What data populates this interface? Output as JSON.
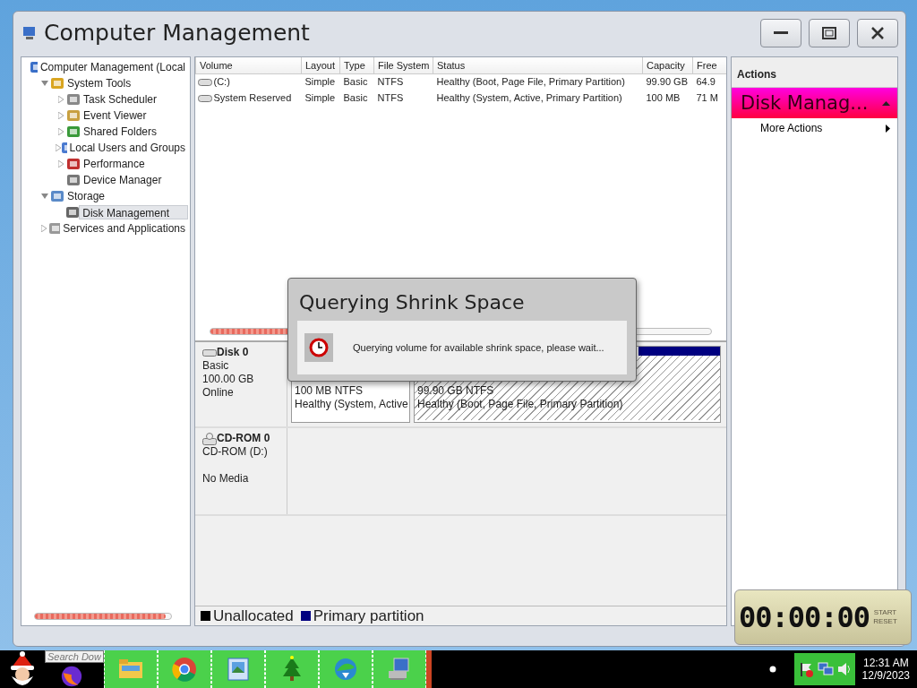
{
  "window": {
    "title": "Computer Management"
  },
  "tree": [
    {
      "label": "Computer Management (Local",
      "selected": false,
      "children": [
        {
          "label": "System Tools",
          "expanded": true,
          "selected": false,
          "children": [
            {
              "label": "Task Scheduler",
              "expanded": false,
              "selected": false
            },
            {
              "label": "Event Viewer",
              "expanded": false,
              "selected": false
            },
            {
              "label": "Shared Folders",
              "expanded": false,
              "selected": false
            },
            {
              "label": "Local Users and Groups",
              "expanded": false,
              "selected": false
            },
            {
              "label": "Performance",
              "expanded": false,
              "selected": false
            },
            {
              "label": "Device Manager",
              "selected": false
            }
          ]
        },
        {
          "label": "Storage",
          "expanded": true,
          "selected": false,
          "children": [
            {
              "label": "Disk Management",
              "selected": true
            }
          ]
        },
        {
          "label": "Services and Applications",
          "expanded": false,
          "selected": false
        }
      ]
    }
  ],
  "volumes": {
    "columns": [
      "Volume",
      "Layout",
      "Type",
      "File System",
      "Status",
      "Capacity",
      "Free"
    ],
    "rows": [
      [
        "(C:)",
        "Simple",
        "Basic",
        "NTFS",
        "Healthy (Boot, Page File, Primary Partition)",
        "99.90 GB",
        "64.9"
      ],
      [
        "System Reserved",
        "Simple",
        "Basic",
        "NTFS",
        "Healthy (System, Active, Primary Partition)",
        "100 MB",
        "71 M"
      ]
    ]
  },
  "disks": [
    {
      "kind": "disk",
      "name": "Disk 0",
      "type": "Basic",
      "size": "100.00 GB",
      "status": "Online",
      "partitions": [
        {
          "size": "100 MB NTFS",
          "status": "Healthy (System, Active",
          "selected": false
        },
        {
          "size": "99.90 GB NTFS",
          "status": "Healthy (Boot, Page File, Primary Partition)",
          "selected": true
        }
      ]
    },
    {
      "kind": "cdrom",
      "name": "CD-ROM 0",
      "type": "CD-ROM (D:)",
      "status": "No Media"
    }
  ],
  "legend": [
    {
      "label": "Unallocated",
      "color": "#000000"
    },
    {
      "label": "Primary partition",
      "color": "#000080"
    }
  ],
  "actions": {
    "header": "Actions",
    "section": {
      "title": "Disk Manag...",
      "expanded": true
    },
    "items": [
      {
        "label": "More Actions"
      }
    ]
  },
  "dialog": {
    "title": "Querying Shrink Space",
    "message": "Querying volume for available shrink space, please wait..."
  },
  "timer": {
    "display": "00:00:00",
    "buttons": [
      "START",
      "RESET"
    ]
  },
  "taskbar": {
    "search": {
      "placeholder": "Search Dow"
    },
    "clock": {
      "time": "12:31 AM",
      "date": "12/9/2023"
    }
  }
}
